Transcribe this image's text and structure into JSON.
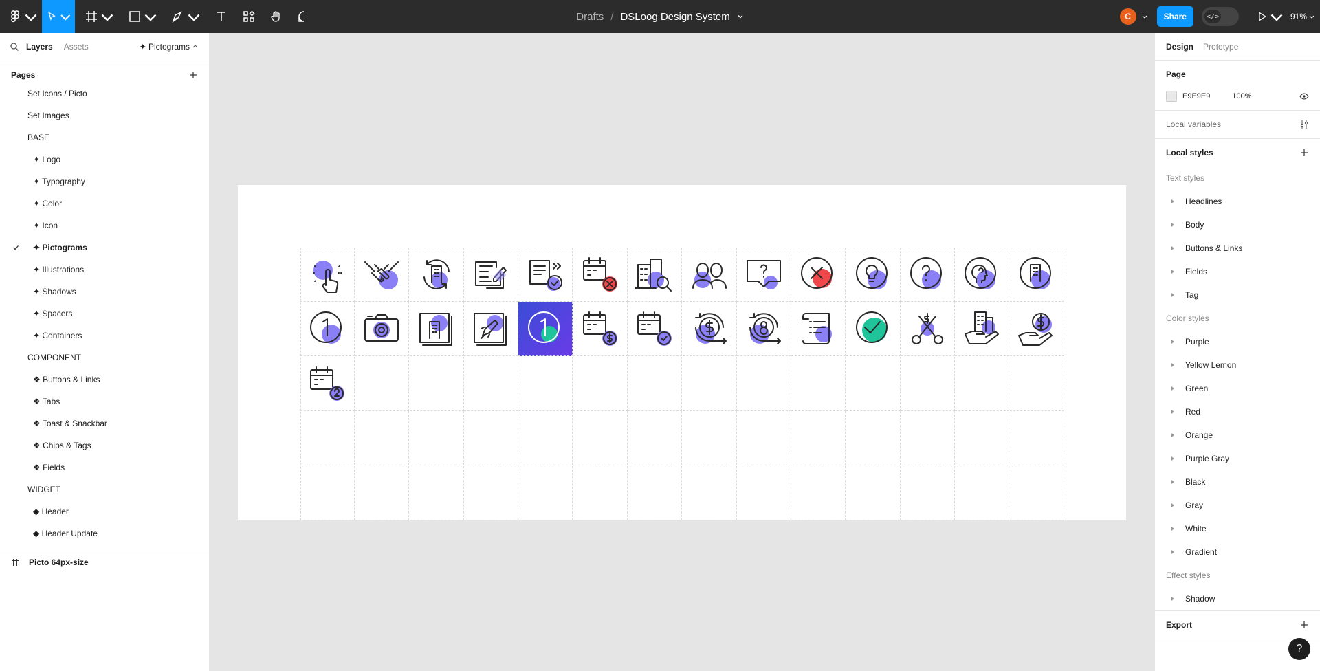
{
  "toolbar": {
    "breadcrumb_root": "Drafts",
    "breadcrumb_sep": "/",
    "file_name": "DSLoog Design System",
    "avatar_initial": "C",
    "share_label": "Share",
    "dev_mode_icon": "</>",
    "zoom_level": "91%"
  },
  "left_panel": {
    "tabs": [
      "Layers",
      "Assets"
    ],
    "page_selector": "✦ Pictograms",
    "pages_title": "Pages",
    "pages": [
      {
        "label": "Set Icons / Picto",
        "indent": false
      },
      {
        "label": "Set Images",
        "indent": false
      },
      {
        "label": "BASE",
        "indent": false
      },
      {
        "label": "✦ Logo",
        "indent": true
      },
      {
        "label": "✦ Typography",
        "indent": true
      },
      {
        "label": "✦ Color",
        "indent": true
      },
      {
        "label": "✦ Icon",
        "indent": true
      },
      {
        "label": "✦ Pictograms",
        "indent": true,
        "selected": true
      },
      {
        "label": "✦ Illustrations",
        "indent": true
      },
      {
        "label": "✦ Shadows",
        "indent": true
      },
      {
        "label": "✦ Spacers",
        "indent": true
      },
      {
        "label": "✦ Containers",
        "indent": true
      },
      {
        "label": "COMPONENT",
        "indent": false
      },
      {
        "label": "❖ Buttons & Links",
        "indent": true
      },
      {
        "label": "❖ Tabs",
        "indent": true
      },
      {
        "label": "❖ Toast & Snackbar",
        "indent": true
      },
      {
        "label": "❖ Chips & Tags",
        "indent": true
      },
      {
        "label": "❖ Fields",
        "indent": true
      },
      {
        "label": "WIDGET",
        "indent": false
      },
      {
        "label": "◆ Header",
        "indent": true
      },
      {
        "label": "◆ Header Update",
        "indent": true
      }
    ],
    "layer_frame": "Picto 64px-size"
  },
  "canvas": {
    "pictograms": [
      "hand-touch-icon",
      "handshake-icon",
      "building-refresh-icon",
      "document-pen-icon",
      "document-check-icon",
      "calendar-cancel-icon",
      "building-search-icon",
      "people-icon",
      "chat-question-icon",
      "circle-x-icon",
      "lightbulb-icon",
      "circle-question-icon",
      "head-profile-icon",
      "building-circle-icon",
      "number-one-icon",
      "camera-icon",
      "building-photo-icon",
      "rocket-photo-icon",
      "number-one-selected-icon",
      "calendar-dollar-icon",
      "calendar-check-icon",
      "dollar-refresh-icon",
      "number-eight-refresh-icon",
      "scroll-list-icon",
      "circle-check-icon",
      "scissors-dollar-icon",
      "hand-building-icon",
      "hand-dollar-icon",
      "calendar-two-icon"
    ],
    "colors": {
      "accent": "#8b7ff5",
      "selected": "#4c45e8",
      "red": "#f0484a",
      "green": "#1fc49a"
    }
  },
  "right_panel": {
    "tabs": [
      "Design",
      "Prototype"
    ],
    "page_title": "Page",
    "page_color": "E9E9E9",
    "page_opacity": "100%",
    "local_variables": "Local variables",
    "local_styles": "Local styles",
    "text_styles_title": "Text styles",
    "text_styles": [
      "Headlines",
      "Body",
      "Buttons & Links",
      "Fields",
      "Tag"
    ],
    "color_styles_title": "Color styles",
    "color_styles": [
      "Purple",
      "Yellow Lemon",
      "Green",
      "Red",
      "Orange",
      "Purple Gray",
      "Black",
      "Gray",
      "White",
      "Gradient"
    ],
    "effect_styles_title": "Effect styles",
    "effect_styles": [
      "Shadow"
    ],
    "export_title": "Export"
  },
  "help_label": "?"
}
